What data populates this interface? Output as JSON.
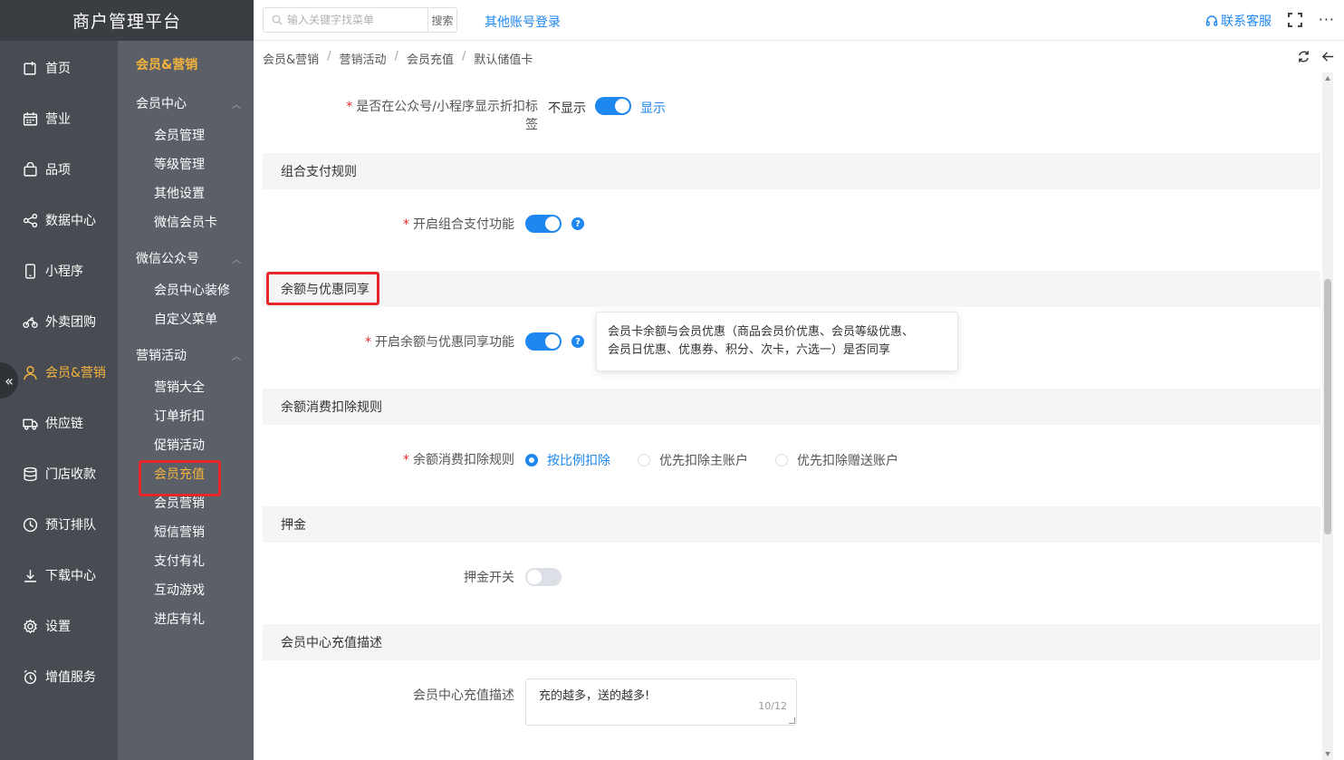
{
  "brand": "商户管理平台",
  "primary_nav": [
    {
      "label": "首页",
      "icon": "home-icon"
    },
    {
      "label": "营业",
      "icon": "calendar-icon"
    },
    {
      "label": "品项",
      "icon": "bag-icon"
    },
    {
      "label": "数据中心",
      "icon": "share-icon"
    },
    {
      "label": "小程序",
      "icon": "phone-icon"
    },
    {
      "label": "外卖团购",
      "icon": "bike-icon"
    },
    {
      "label": "会员&营销",
      "icon": "user-icon",
      "active": true
    },
    {
      "label": "供应链",
      "icon": "truck-icon"
    },
    {
      "label": "门店收款",
      "icon": "database-icon"
    },
    {
      "label": "预订排队",
      "icon": "clock-icon"
    },
    {
      "label": "下载中心",
      "icon": "download-icon"
    },
    {
      "label": "设置",
      "icon": "gear-icon"
    },
    {
      "label": "增值服务",
      "icon": "alarm-icon"
    }
  ],
  "secondary_nav": {
    "head": "会员&营销",
    "groups": [
      {
        "label": "会员中心",
        "items": [
          "会员管理",
          "等级管理",
          "其他设置",
          "微信会员卡"
        ]
      },
      {
        "label": "微信公众号",
        "items": [
          "会员中心装修",
          "自定义菜单"
        ]
      },
      {
        "label": "营销活动",
        "items": [
          "营销大全",
          "订单折扣",
          "促销活动",
          "会员充值",
          "会员营销",
          "短信营销",
          "支付有礼",
          "互动游戏",
          "进店有礼"
        ]
      }
    ]
  },
  "topbar": {
    "search_placeholder": "输入关键字找菜单",
    "search_button": "搜索",
    "other_login": "其他账号登录",
    "support": "联系客服",
    "more": "···"
  },
  "breadcrumb": [
    "会员&营销",
    "营销活动",
    "会员充值",
    "默认储值卡"
  ],
  "form": {
    "discount_tag": {
      "label": "是否在公众号/小程序显示折扣标签",
      "off_text": "不显示",
      "on_text": "显示",
      "on": true
    },
    "combo_section": "组合支付规则",
    "combo_label": "开启组合支付功能",
    "combo_on": true,
    "share_section": "余额与优惠同享",
    "share_label": "开启余额与优惠同享功能",
    "share_on": true,
    "share_tip_line1": "会员卡余额与会员优惠（商品会员价优惠、会员等级优惠、",
    "share_tip_line2": "会员日优惠、优惠券、积分、次卡，六选一）是否同享",
    "deduct_section": "余额消费扣除规则",
    "deduct_label": "余额消费扣除规则",
    "deduct_options": [
      "按比例扣除",
      "优先扣除主账户",
      "优先扣除赠送账户"
    ],
    "deduct_selected": "按比例扣除",
    "deposit_section": "押金",
    "deposit_label": "押金开关",
    "deposit_on": false,
    "desc_section": "会员中心充值描述",
    "desc_label": "会员中心充值描述",
    "desc_value": "充的越多，送的越多!",
    "desc_count": "10/12"
  },
  "colors": {
    "accent": "#1e87f0",
    "active_nav": "#f5b43c",
    "highlight": "#e5262a"
  }
}
